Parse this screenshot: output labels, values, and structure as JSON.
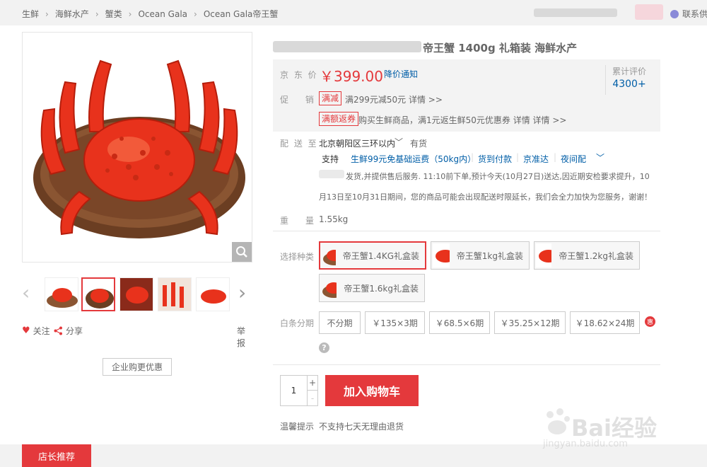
{
  "breadcrumb": [
    "生鲜",
    "海鲜水产",
    "蟹类",
    "Ocean Gala",
    "Ocean Gala帝王蟹"
  ],
  "header": {
    "contact_label": "联系供"
  },
  "product": {
    "title": "帝王蟹 1400g 礼箱装 海鲜水产",
    "price_label": "京 东 价",
    "price": "￥399.00",
    "price_notify": "降价通知",
    "rating_label": "累计评价",
    "rating_value": "4300+",
    "promo_label": "促 销",
    "promos": [
      {
        "tag": "满减",
        "text": "满299元减50元  详情 >>"
      },
      {
        "tag": "满额返券",
        "text": "购买生鲜商品，满1元返生鲜50元优惠券  详情  详情 >>"
      }
    ]
  },
  "shipping": {
    "label": "配 送 至",
    "location": "北京朝阳区三环以内",
    "stock": "有货",
    "support_label": "支持",
    "support_items": [
      "生鲜99元免基础运费（50kg内）",
      "货到付款",
      "京准达",
      "夜间配"
    ],
    "notice_line1": "发货,并提供售后服务. 11:10前下单,预计今天(10月27日)送达,因近期安检要求提升，10",
    "notice_line2": "月13日至10月31日期间，您的商品可能会出现配送时限延长，我们会全力加快为您服务，谢谢！"
  },
  "weight": {
    "label": "重　量",
    "value": "1.55kg"
  },
  "variants": {
    "label": "选择种类",
    "options": [
      "帝王蟹1.4KG礼盒装",
      "帝王蟹1kg礼盒装",
      "帝王蟹1.2kg礼盒装",
      "帝王蟹1.6kg礼盒装"
    ],
    "selected_index": 0
  },
  "installments": {
    "label": "白条分期",
    "options": [
      "不分期",
      "￥135×3期",
      "￥68.5×6期",
      "￥35.25×12期",
      "￥18.62×24期"
    ],
    "badge": "惠"
  },
  "quantity": {
    "value": "1",
    "plus": "+",
    "minus": "-"
  },
  "cart_button": "加入购物车",
  "tip": {
    "label": "温馨提示",
    "text": "不支持七天无理由退货"
  },
  "gallery": {
    "follow": "关注",
    "share": "分享",
    "report": "举报",
    "enterprise_button": "企业购更优惠",
    "selected_thumb": 1
  },
  "bottom_tab": "店长推荐",
  "watermark": {
    "brand": "Bai经验",
    "url": "jingyan.baidu.com"
  },
  "colors": {
    "accent_red": "#e4393c",
    "link_blue": "#005ea7",
    "crab_red": "#e8321c",
    "board_brown": "#6b3e22"
  }
}
